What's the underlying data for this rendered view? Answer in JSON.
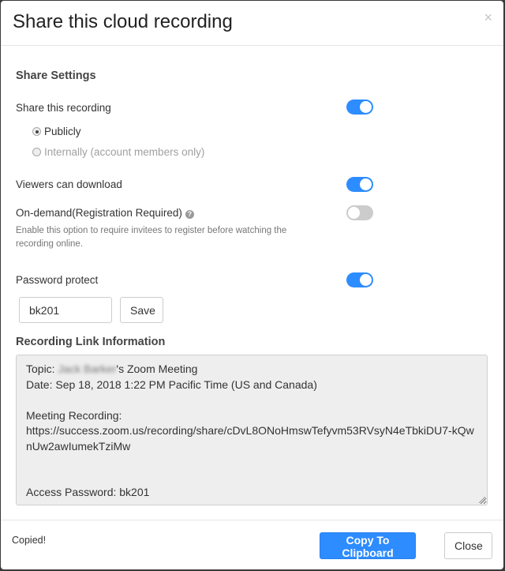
{
  "dialog": {
    "title": "Share this cloud recording",
    "close_icon": "×"
  },
  "settings": {
    "section_title": "Share Settings",
    "share_recording": {
      "label": "Share this recording",
      "enabled": true
    },
    "share_options": [
      {
        "label": "Publicly",
        "checked": true,
        "disabled": false
      },
      {
        "label": "Internally (account members only)",
        "checked": false,
        "disabled": true
      }
    ],
    "viewers_download": {
      "label": "Viewers can download",
      "enabled": true
    },
    "on_demand": {
      "label": "On-demand(Registration Required)",
      "help_icon": "?",
      "hint": "Enable this option to require invitees to register before watching the recording online.",
      "enabled": false
    },
    "password_protect": {
      "label": "Password protect",
      "enabled": true,
      "value": "bk201",
      "save_label": "Save"
    }
  },
  "link_info": {
    "section_title": "Recording Link Information",
    "topic_prefix": "Topic: ",
    "topic_redacted": "Jack Barker",
    "topic_suffix": "'s Zoom Meeting",
    "date_line": "Date: Sep 18, 2018 1:22 PM Pacific Time (US and Canada)",
    "recording_label": "Meeting Recording:",
    "recording_url": "https://success.zoom.us/recording/share/cDvL8ONoHmswTefyvm53RVsyN4eTbkiDU7-kQwnUw2awIumekTziMw",
    "password_line": "Access Password: bk201"
  },
  "footer": {
    "status": "Copied!",
    "copy_label": "Copy To Clipboard",
    "close_label": "Close"
  },
  "colors": {
    "accent": "#2d8cff",
    "toggle_off": "#cccccc",
    "link_box_bg": "#eeeeee"
  }
}
